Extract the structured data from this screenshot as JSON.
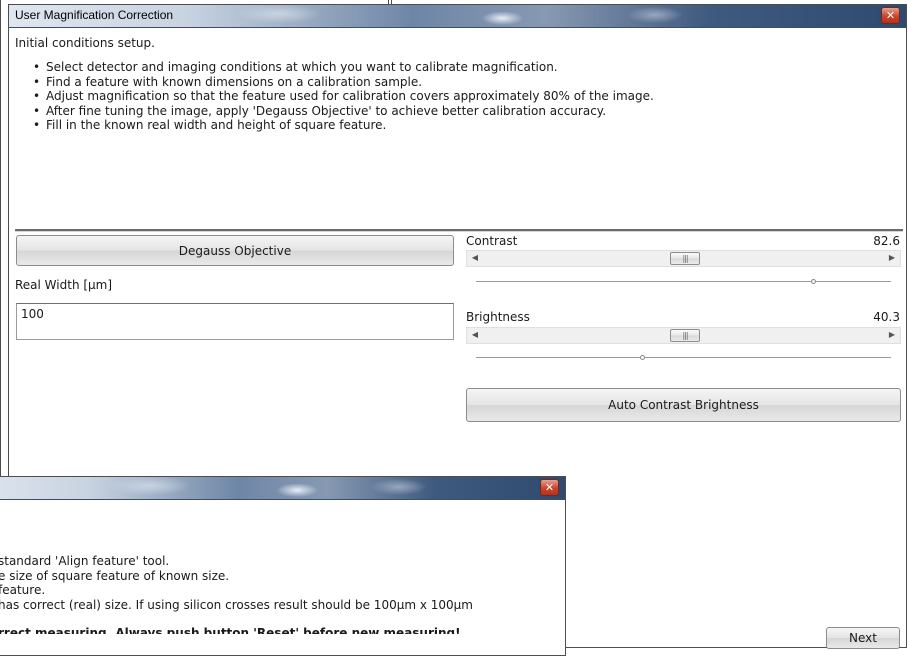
{
  "main_dialog": {
    "title": "User Magnification Correction",
    "intro": "Initial conditions setup.",
    "instructions": [
      "Select detector and imaging conditions at which you want to calibrate magnification.",
      "Find a feature with known dimensions on a calibration sample.",
      "Adjust magnification so that the feature used for calibration covers approximately 80% of the image.",
      "After fine tuning the image, apply 'Degauss Objective' to achieve better calibration accuracy.",
      "Fill in the known real width and height of square feature."
    ],
    "degauss_button": "Degauss Objective",
    "real_width_label": "Real Width [µm]",
    "real_width_value": "100",
    "contrast": {
      "label": "Contrast",
      "value": "82.6",
      "level": 0.826
    },
    "brightness": {
      "label": "Brightness",
      "value": "40.3",
      "level": 0.403
    },
    "auto_button": "Auto Contrast Brightness",
    "next_button": "Next",
    "close_glyph": "✕"
  },
  "behind_dialog": {
    "close_glyph": "✕",
    "lines": [
      "standard 'Align feature' tool.",
      "e size of square feature of known size.",
      "feature.",
      "has correct (real) size. If using silicon crosses result should be 100µm x 100µm"
    ],
    "bold_line": "rrect measuring. Always push button 'Reset' before new measuring!"
  },
  "icons": {
    "close": "close-icon",
    "scroll_left": "scroll-left-arrow-icon",
    "scroll_right": "scroll-right-arrow-icon",
    "grip": "grip-icon"
  },
  "colors": {
    "titlebar_dark": "#2f4a70",
    "titlebar_light": "#dfe6ef",
    "close_red": "#c9442b",
    "window_border": "#4d4d4d"
  }
}
